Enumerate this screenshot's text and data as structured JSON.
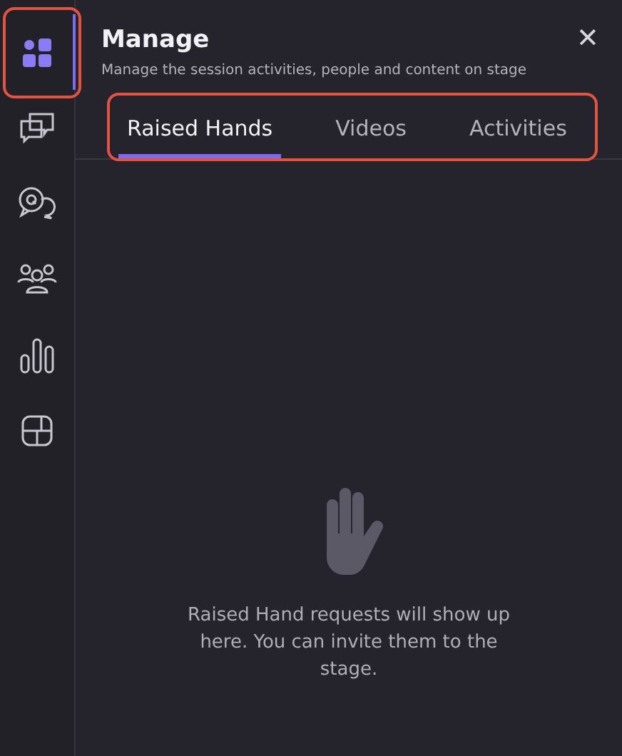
{
  "sidebar": {
    "items": [
      {
        "selected": true,
        "highlighted": true
      },
      {
        "selected": false,
        "highlighted": false
      },
      {
        "selected": false,
        "highlighted": false
      },
      {
        "selected": false,
        "highlighted": false
      },
      {
        "selected": false,
        "highlighted": false
      },
      {
        "selected": false,
        "highlighted": false
      }
    ]
  },
  "panel": {
    "title": "Manage",
    "subtitle": "Manage the session activities, people and content on stage",
    "close": "✕",
    "tabs_highlighted": true,
    "tabs": [
      {
        "label": "Raised Hands",
        "selected": true
      },
      {
        "label": "Videos",
        "selected": false
      },
      {
        "label": "Activities",
        "selected": false
      }
    ],
    "empty_message": "Raised Hand requests will show up here. You can invite them to the stage."
  }
}
